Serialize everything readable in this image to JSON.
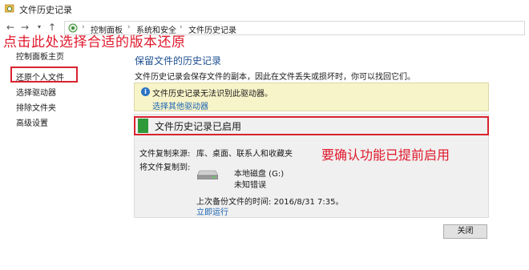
{
  "window": {
    "title": "文件历史记录"
  },
  "address": {
    "crumbs": [
      "控制面板",
      "系统和安全",
      "文件历史记录"
    ]
  },
  "annotations": {
    "top": "点击此处选择合适的版本还原",
    "right": "要确认功能已提前启用"
  },
  "sidebar": {
    "home": "控制面板主页",
    "items": [
      {
        "label": "还原个人文件"
      },
      {
        "label": "选择驱动器"
      },
      {
        "label": "排除文件夹"
      },
      {
        "label": "高级设置"
      }
    ]
  },
  "main": {
    "title": "保留文件的历史记录",
    "description": "文件历史记录会保存文件的副本，因此在文件丢失或损坏时，你可以找回它们。",
    "info": {
      "text": "文件历史记录无法识别此驱动器。",
      "link": "选择其他驱动器"
    },
    "status": "文件历史记录已启用",
    "copy_from_label": "文件复制来源:",
    "copy_from_value": "库、桌面、联系人和收藏夹",
    "copy_to_label": "将文件复制到:",
    "drive_name": "本地磁盘 (G:)",
    "drive_sub": "未知错误",
    "last_backup": "上次备份文件的时间: 2016/8/31 7:35。",
    "run_now": "立即运行",
    "close": "关闭"
  },
  "colors": {
    "accent_red": "#e0182b",
    "title_blue": "#1e4f91",
    "link_blue": "#1a64b4",
    "status_green": "#2e9a3a",
    "info_bg": "#f8f4c9"
  },
  "icons": [
    "file-history-icon",
    "back-arrow-icon",
    "forward-arrow-icon",
    "dropdown-icon",
    "up-arrow-icon",
    "control-panel-icon",
    "info-icon",
    "drive-icon",
    "status-flag-icon"
  ]
}
